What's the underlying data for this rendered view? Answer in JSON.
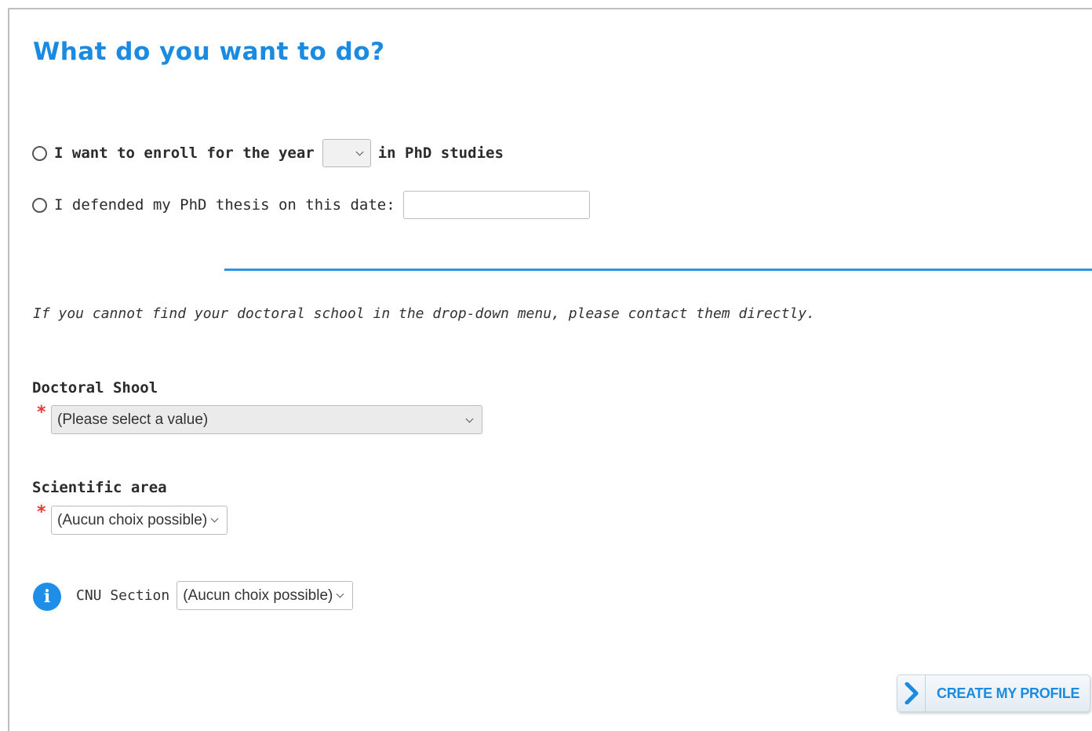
{
  "page": {
    "title": "What do you want to do?"
  },
  "enroll_option": {
    "text_before": "I want to enroll for the year",
    "year_value": "",
    "text_after": "in PhD studies"
  },
  "defended_option": {
    "text": "I defended my PhD thesis on this date:",
    "date_value": ""
  },
  "note": "If you cannot find your doctoral school in the drop-down menu, please contact them directly.",
  "doctoral_school": {
    "label": "Doctoral Shool",
    "required_mark": "*",
    "selected": "(Please select a value)"
  },
  "scientific_area": {
    "label": "Scientific area",
    "required_mark": "*",
    "selected": "(Aucun choix possible)"
  },
  "cnu_section": {
    "info_icon": "info-icon",
    "info_glyph": "i",
    "label": "CNU Section",
    "selected": "(Aucun choix possible)"
  },
  "actions": {
    "create_profile_label": "CREATE MY PROFILE",
    "create_profile_icon": "chevron-right-icon"
  },
  "colors": {
    "accent": "#1a8be0",
    "separator": "#2f93e6",
    "required": "#e53935"
  }
}
